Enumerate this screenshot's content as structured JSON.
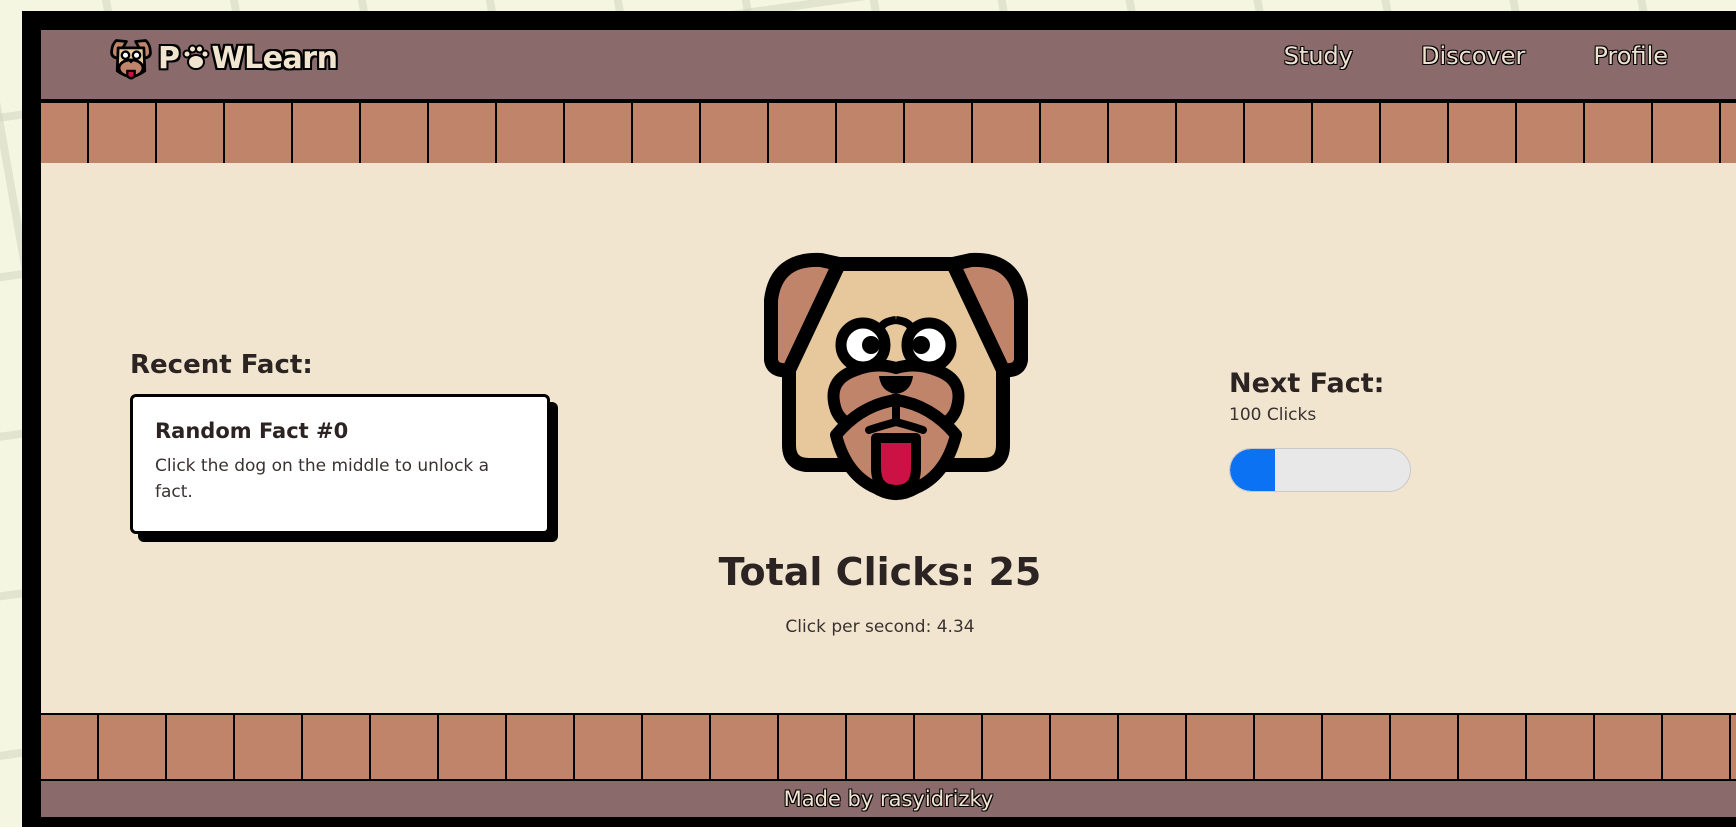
{
  "header": {
    "logo_left": "P",
    "logo_right": "WLearn",
    "nav": [
      {
        "label": "Study"
      },
      {
        "label": "Discover"
      },
      {
        "label": "Profile"
      }
    ]
  },
  "recent_fact": {
    "title": "Recent Fact:",
    "card_title": "Random Fact #0",
    "card_body": "Click the dog on the middle to unlock a fact."
  },
  "stats": {
    "total_clicks": "Total Clicks: 25",
    "click_per_second": "Click per second: 4.34"
  },
  "next_fact": {
    "title": "Next Fact:",
    "threshold": "100 Clicks",
    "progress": 0.25
  },
  "footer": {
    "credit": "Made by rasyidrizky"
  },
  "colors": {
    "accent": "#0b72f4",
    "nav_bg": "#8a6a6b",
    "tile": "#c0846b",
    "content_bg": "#f1e5d0",
    "dog_face": "#e6c89c",
    "dog_ear": "#c0846b",
    "tongue": "#cc1145"
  },
  "icons": {
    "logo": "dog-face-icon",
    "paw": "paw-icon",
    "clicker": "dog-face-icon"
  }
}
